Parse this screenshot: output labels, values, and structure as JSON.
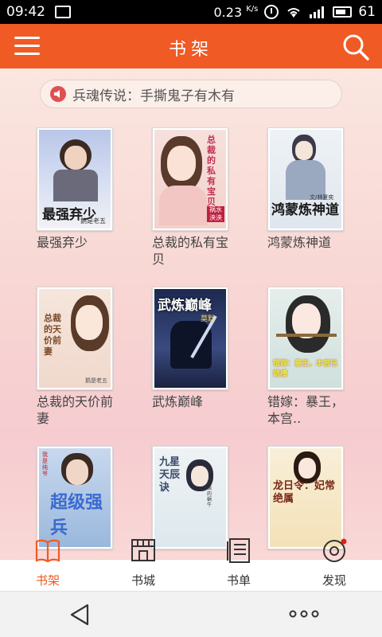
{
  "status_bar": {
    "time": "09:42",
    "speed": "0.23",
    "speed_unit": "K/s",
    "battery": "61"
  },
  "header": {
    "title": "书架",
    "menu_icon": "menu-icon",
    "search_icon": "search-icon"
  },
  "notice": {
    "icon": "speaker-icon",
    "text": "兵魂传说：手撕鬼子有木有"
  },
  "books": [
    {
      "name": "最强弃少",
      "cover_text": "最强弃少",
      "cover_sub": "鹅是老五",
      "color": "#a4b8e0"
    },
    {
      "name": "总裁的私有宝贝",
      "cover_text": "总裁的私有宝贝",
      "cover_sub": "祸水泱泱",
      "color": "#e8b4b4"
    },
    {
      "name": "鸿蒙炼神道",
      "cover_text": "鸿蒙炼神道",
      "cover_sub": "文/林夏奕",
      "color": "#dfe6ee"
    },
    {
      "name": "总裁的天价前妻",
      "cover_text": "总裁的天价前妻",
      "cover_sub": "鹅是老五",
      "color": "#f0d8cc"
    },
    {
      "name": "武炼巅峰",
      "cover_text": "武炼巅峰",
      "cover_sub": "莫默",
      "color": "#2a3a66"
    },
    {
      "name": "错嫁：暴王，本宫..",
      "cover_text": "错嫁：暴王，本宫已跳槽",
      "cover_sub": "",
      "color": "#cfe0dc"
    },
    {
      "name": "",
      "cover_text": "超级强兵",
      "cover_sub": "我是纯爷",
      "color": "#9ab8dc"
    },
    {
      "name": "",
      "cover_text": "九星天辰诀",
      "cover_sub": "发飙的蜗牛",
      "color": "#dde8ee"
    },
    {
      "name": "",
      "cover_text": "龙日令：妃常绝属",
      "cover_sub": "",
      "color": "#f4e6c0"
    }
  ],
  "tabs": [
    {
      "label": "书架",
      "icon": "book-open-icon",
      "active": true
    },
    {
      "label": "书城",
      "icon": "store-icon",
      "active": false
    },
    {
      "label": "书单",
      "icon": "list-icon",
      "active": false
    },
    {
      "label": "发现",
      "icon": "discover-icon",
      "active": false,
      "badge": true
    }
  ],
  "nav": {
    "back_icon": "back-triangle-icon",
    "more_icon": "more-dots-icon"
  },
  "colors": {
    "accent": "#f05a25",
    "active_tab": "#f05a25",
    "tab_text": "#333333"
  }
}
